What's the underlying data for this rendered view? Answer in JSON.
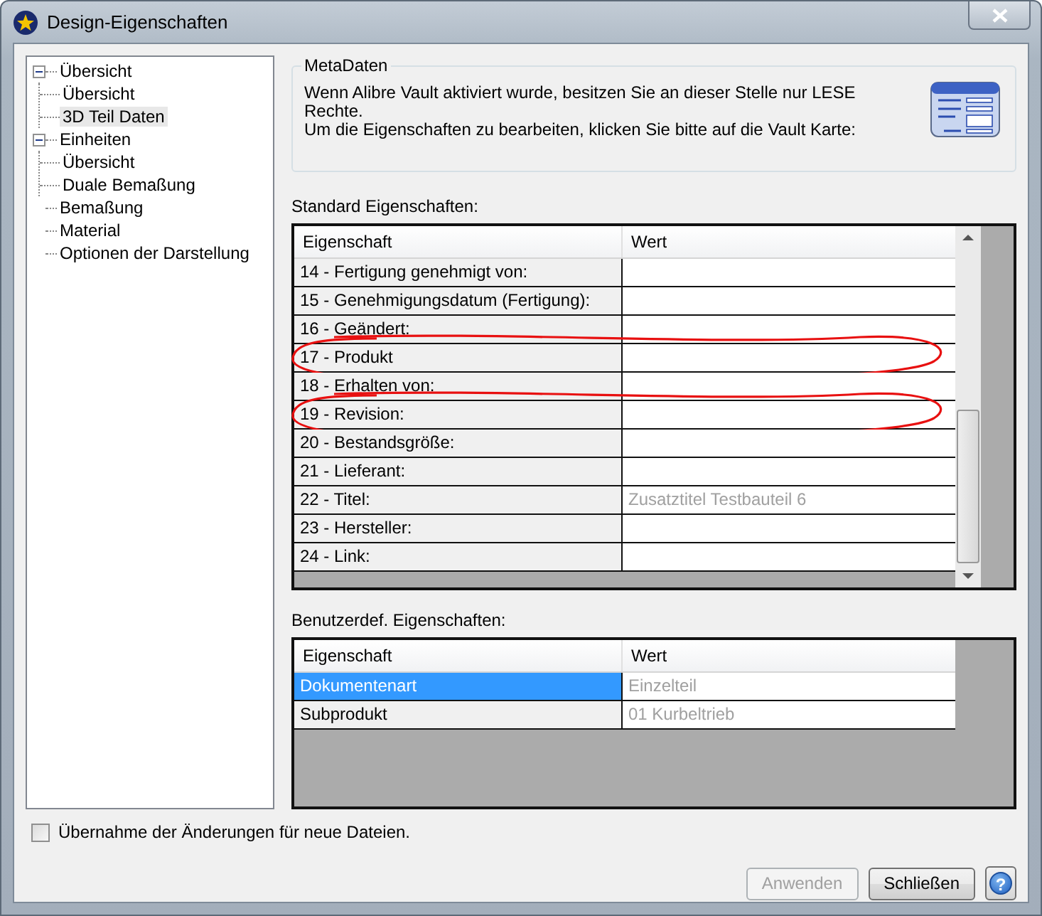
{
  "window": {
    "title": "Design-Eigenschaften"
  },
  "tree": [
    {
      "label": "Übersicht",
      "expanded": true,
      "selected": false,
      "children": [
        {
          "label": "Übersicht",
          "selected": false
        },
        {
          "label": "3D Teil Daten",
          "selected": true
        }
      ]
    },
    {
      "label": "Einheiten",
      "expanded": true,
      "selected": false,
      "children": [
        {
          "label": "Übersicht",
          "selected": false
        },
        {
          "label": "Duale Bemaßung",
          "selected": false
        }
      ]
    },
    {
      "label": "Bemaßung",
      "selected": false
    },
    {
      "label": "Material",
      "selected": false
    },
    {
      "label": "Optionen der Darstellung",
      "selected": false
    }
  ],
  "metadata": {
    "title": "MetaDaten",
    "paragraphs": [
      "Wenn Alibre Vault aktiviert wurde, besitzen Sie an dieser Stelle nur LESE Rechte.",
      "Um die Eigenschaften zu bearbeiten, klicken Sie bitte auf die Vault Karte:"
    ]
  },
  "standard": {
    "label": "Standard Eigenschaften:",
    "columns": [
      "Eigenschaft",
      "Wert"
    ],
    "rows": [
      {
        "property": "14 - Fertigung genehmigt von:",
        "circled": false
      },
      {
        "property": "15 - Genehmigungsdatum (Fertigung):",
        "circled": false
      },
      {
        "property": "16 - Geändert:",
        "circled": false
      },
      {
        "property": "17 - Produkt",
        "circled": true
      },
      {
        "property": "18 - Erhalten von:",
        "circled": false
      },
      {
        "property": "19 - Revision:",
        "circled": true
      },
      {
        "property": "20 - Bestandsgröße:",
        "circled": false
      },
      {
        "property": "21 - Lieferant:",
        "circled": false
      },
      {
        "property": "22 - Titel:",
        "value": "Zusatztitel Testbauteil 6",
        "circled": false
      },
      {
        "property": "23 - Hersteller:",
        "circled": false
      },
      {
        "property": "24 - Link:",
        "circled": false
      }
    ]
  },
  "custom": {
    "label": "Benutzerdef. Eigenschaften:",
    "columns": [
      "Eigenschaft",
      "Wert"
    ],
    "rows": [
      {
        "property": "Dokumentenart",
        "value": "Einzelteil",
        "selected": true
      },
      {
        "property": "Subprodukt",
        "value": "01 Kurbeltrieb",
        "selected": false
      }
    ]
  },
  "apply_to_new": {
    "label": "Übernahme der Änderungen für neue Dateien.",
    "checked": false
  },
  "buttons": [
    {
      "label": "Anwenden",
      "disabled": true
    },
    {
      "label": "Schließen",
      "disabled": false
    }
  ],
  "help_button": {
    "label": "?"
  }
}
